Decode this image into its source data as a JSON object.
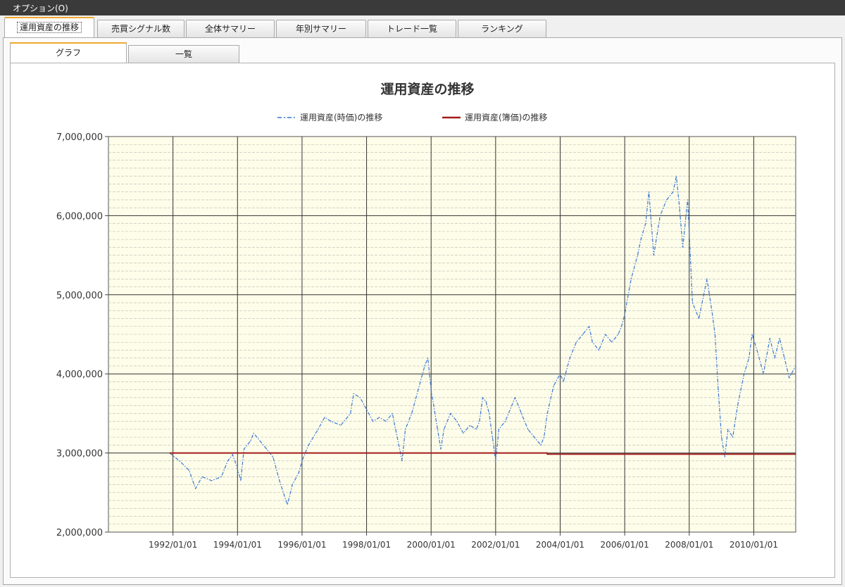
{
  "menubar": {
    "option_label": "オプション(O)"
  },
  "tabs": [
    {
      "label": "運用資産の推移",
      "active": true
    },
    {
      "label": "売買シグナル数",
      "active": false
    },
    {
      "label": "全体サマリー",
      "active": false
    },
    {
      "label": "年別サマリー",
      "active": false
    },
    {
      "label": "トレード一覧",
      "active": false
    },
    {
      "label": "ランキング",
      "active": false
    }
  ],
  "subtabs": [
    {
      "label": "グラフ",
      "active": true
    },
    {
      "label": "一覧",
      "active": false
    }
  ],
  "colors": {
    "plot_background": "#fdfde9",
    "market_value_line": "#3a76d6",
    "book_value_line": "#a31d1d",
    "grid_major": "#333333",
    "grid_minor": "#b8b8b8",
    "tab_accent": "#f0a830"
  },
  "chart_data": {
    "type": "line",
    "title": "運用資産の推移",
    "xlabel": "",
    "ylabel": "",
    "grid": true,
    "legend_position": "top-center",
    "ylim": [
      2000000,
      7000000
    ],
    "xlim": [
      1990.0,
      2011.3
    ],
    "y_ticks": [
      "2,000,000",
      "3,000,000",
      "4,000,000",
      "5,000,000",
      "6,000,000",
      "7,000,000"
    ],
    "x_ticks": [
      "1992/01/01",
      "1994/01/01",
      "1996/01/01",
      "1998/01/01",
      "2000/01/01",
      "2002/01/01",
      "2004/01/01",
      "2006/01/01",
      "2008/01/01",
      "2010/01/01"
    ],
    "series": [
      {
        "name": "運用資産(時価)の推移",
        "style": "dash-dot",
        "color": "#3a76d6",
        "points": [
          [
            1991.9,
            3000000
          ],
          [
            1992.2,
            2900000
          ],
          [
            1992.5,
            2780000
          ],
          [
            1992.7,
            2550000
          ],
          [
            1992.9,
            2700000
          ],
          [
            1993.2,
            2650000
          ],
          [
            1993.5,
            2700000
          ],
          [
            1993.7,
            2900000
          ],
          [
            1993.85,
            2980000
          ],
          [
            1994.0,
            2800000
          ],
          [
            1994.1,
            2650000
          ],
          [
            1994.2,
            3050000
          ],
          [
            1994.4,
            3150000
          ],
          [
            1994.5,
            3250000
          ],
          [
            1994.7,
            3150000
          ],
          [
            1994.9,
            3050000
          ],
          [
            1995.1,
            2950000
          ],
          [
            1995.3,
            2650000
          ],
          [
            1995.5,
            2400000
          ],
          [
            1995.55,
            2350000
          ],
          [
            1995.7,
            2600000
          ],
          [
            1995.9,
            2750000
          ],
          [
            1996.0,
            2900000
          ],
          [
            1996.2,
            3100000
          ],
          [
            1996.5,
            3300000
          ],
          [
            1996.7,
            3450000
          ],
          [
            1996.9,
            3400000
          ],
          [
            1997.2,
            3350000
          ],
          [
            1997.5,
            3500000
          ],
          [
            1997.6,
            3750000
          ],
          [
            1997.8,
            3700000
          ],
          [
            1998.0,
            3550000
          ],
          [
            1998.2,
            3400000
          ],
          [
            1998.4,
            3450000
          ],
          [
            1998.6,
            3400000
          ],
          [
            1998.8,
            3500000
          ],
          [
            1998.9,
            3300000
          ],
          [
            1999.0,
            3100000
          ],
          [
            1999.1,
            2900000
          ],
          [
            1999.2,
            3300000
          ],
          [
            1999.4,
            3500000
          ],
          [
            1999.6,
            3800000
          ],
          [
            1999.8,
            4100000
          ],
          [
            1999.9,
            4200000
          ],
          [
            2000.0,
            3800000
          ],
          [
            2000.2,
            3300000
          ],
          [
            2000.3,
            3050000
          ],
          [
            2000.4,
            3300000
          ],
          [
            2000.6,
            3500000
          ],
          [
            2000.8,
            3400000
          ],
          [
            2001.0,
            3250000
          ],
          [
            2001.2,
            3350000
          ],
          [
            2001.4,
            3300000
          ],
          [
            2001.5,
            3400000
          ],
          [
            2001.6,
            3700000
          ],
          [
            2001.7,
            3650000
          ],
          [
            2001.8,
            3500000
          ],
          [
            2001.9,
            3200000
          ],
          [
            2002.0,
            2900000
          ],
          [
            2002.1,
            3300000
          ],
          [
            2002.3,
            3400000
          ],
          [
            2002.5,
            3600000
          ],
          [
            2002.6,
            3700000
          ],
          [
            2002.8,
            3500000
          ],
          [
            2003.0,
            3300000
          ],
          [
            2003.2,
            3200000
          ],
          [
            2003.4,
            3100000
          ],
          [
            2003.5,
            3200000
          ],
          [
            2003.6,
            3500000
          ],
          [
            2003.8,
            3850000
          ],
          [
            2004.0,
            4000000
          ],
          [
            2004.1,
            3900000
          ],
          [
            2004.3,
            4200000
          ],
          [
            2004.5,
            4400000
          ],
          [
            2004.7,
            4500000
          ],
          [
            2004.9,
            4600000
          ],
          [
            2005.0,
            4400000
          ],
          [
            2005.2,
            4300000
          ],
          [
            2005.4,
            4500000
          ],
          [
            2005.6,
            4400000
          ],
          [
            2005.8,
            4500000
          ],
          [
            2005.9,
            4600000
          ],
          [
            2006.0,
            4750000
          ],
          [
            2006.2,
            5200000
          ],
          [
            2006.4,
            5500000
          ],
          [
            2006.5,
            5700000
          ],
          [
            2006.65,
            5900000
          ],
          [
            2006.75,
            6300000
          ],
          [
            2006.9,
            5500000
          ],
          [
            2007.1,
            6000000
          ],
          [
            2007.3,
            6200000
          ],
          [
            2007.5,
            6300000
          ],
          [
            2007.6,
            6500000
          ],
          [
            2007.7,
            6100000
          ],
          [
            2007.8,
            5600000
          ],
          [
            2007.95,
            6200000
          ],
          [
            2008.0,
            5800000
          ],
          [
            2008.1,
            4900000
          ],
          [
            2008.3,
            4700000
          ],
          [
            2008.45,
            5000000
          ],
          [
            2008.55,
            5200000
          ],
          [
            2008.7,
            4800000
          ],
          [
            2008.8,
            4500000
          ],
          [
            2008.9,
            3800000
          ],
          [
            2009.0,
            3200000
          ],
          [
            2009.1,
            2950000
          ],
          [
            2009.2,
            3300000
          ],
          [
            2009.35,
            3200000
          ],
          [
            2009.5,
            3600000
          ],
          [
            2009.7,
            4000000
          ],
          [
            2009.85,
            4200000
          ],
          [
            2009.95,
            4500000
          ],
          [
            2010.1,
            4300000
          ],
          [
            2010.3,
            4000000
          ],
          [
            2010.5,
            4450000
          ],
          [
            2010.65,
            4200000
          ],
          [
            2010.8,
            4450000
          ],
          [
            2010.95,
            4200000
          ],
          [
            2011.1,
            3950000
          ],
          [
            2011.3,
            4100000
          ]
        ]
      },
      {
        "name": "運用資産(簿価)の推移",
        "style": "solid",
        "color": "#a31d1d",
        "points": [
          [
            1991.9,
            3000000
          ],
          [
            2003.6,
            3000000
          ],
          [
            2003.6,
            2985000
          ],
          [
            2011.3,
            2985000
          ]
        ]
      }
    ]
  }
}
